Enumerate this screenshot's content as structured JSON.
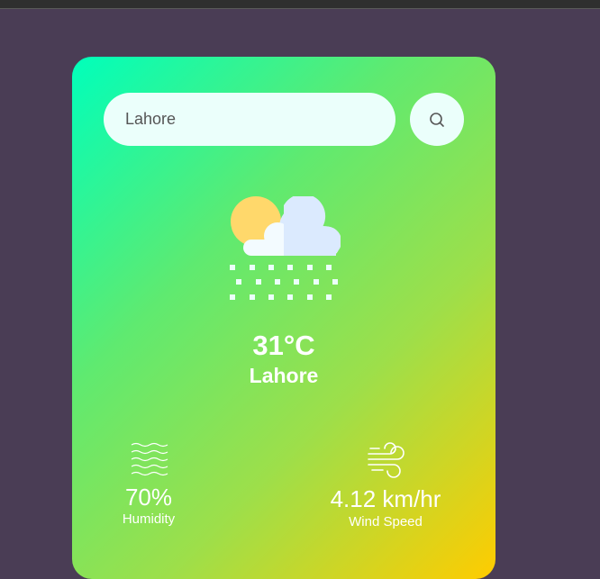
{
  "search": {
    "value": "Lahore",
    "button_icon": "search-icon"
  },
  "weather": {
    "icon": "cloud-sun-snow-icon",
    "temperature": "31°C",
    "city": "Lahore"
  },
  "details": {
    "humidity": {
      "icon": "humidity-waves-icon",
      "value": "70%",
      "label": "Humidity"
    },
    "wind": {
      "icon": "wind-icon",
      "value": "4.12 km/hr",
      "label": "Wind Speed"
    }
  },
  "colors": {
    "page_background": "#4a3d55",
    "card_gradient_start": "#00ffbb",
    "card_gradient_end": "#ffcc00",
    "input_background": "#ebfffb"
  }
}
